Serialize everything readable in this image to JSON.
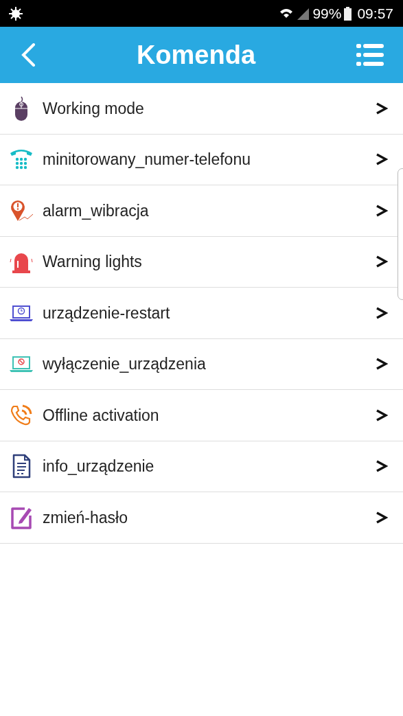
{
  "status_bar": {
    "battery": "99%",
    "time": "09:57"
  },
  "header": {
    "title": "Komenda"
  },
  "items": [
    {
      "kind": "mouse",
      "label": "Working mode"
    },
    {
      "kind": "phone",
      "label": "minitorowany_numer-telefonu"
    },
    {
      "kind": "alarm",
      "label": "alarm_wibracja"
    },
    {
      "kind": "siren",
      "label": "Warning lights"
    },
    {
      "kind": "restart",
      "label": "urządzenie-restart"
    },
    {
      "kind": "shutdown",
      "label": "wyłączenie_urządzenia"
    },
    {
      "kind": "call",
      "label": "Offline activation"
    },
    {
      "kind": "document",
      "label": "info_urządzenie"
    },
    {
      "kind": "edit",
      "label": "zmień-hasło"
    }
  ]
}
